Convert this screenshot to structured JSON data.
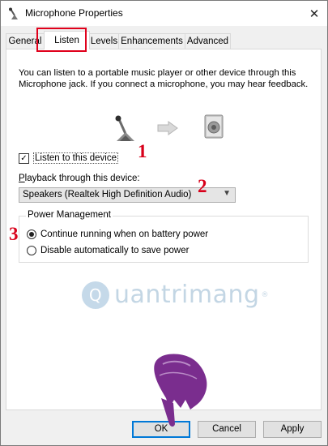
{
  "window": {
    "title": "Microphone Properties",
    "close_glyph": "✕"
  },
  "tabs": [
    {
      "label": "General"
    },
    {
      "label": "Listen"
    },
    {
      "label": "Levels"
    },
    {
      "label": "Enhancements"
    },
    {
      "label": "Advanced"
    }
  ],
  "active_tab": "Listen",
  "listen": {
    "description": "You can listen to a portable music player or other device through this Microphone jack.  If you connect a microphone, you may hear feedback.",
    "checkbox_label": "Listen to this device",
    "checkbox_checked": true,
    "playback_label": "Playback through this device:",
    "playback_selected": "Speakers (Realtek High Definition Audio)",
    "power_group_title": "Power Management",
    "radio_options": [
      {
        "label": "Continue running when on battery power",
        "checked": true
      },
      {
        "label": "Disable automatically to save power",
        "checked": false
      }
    ]
  },
  "annotations": {
    "numbers": [
      "1",
      "2",
      "3"
    ],
    "highlight_color": "#e0001b"
  },
  "watermark": {
    "text": "uantrimang",
    "registered": "®"
  },
  "buttons": {
    "ok": "OK",
    "cancel": "Cancel",
    "apply": "Apply"
  },
  "icons": {
    "title": "microphone-icon",
    "mic": "microphone-stand-icon",
    "arrow": "right-arrow-icon",
    "speaker": "speaker-icon",
    "hand": "pointing-hand-icon"
  }
}
